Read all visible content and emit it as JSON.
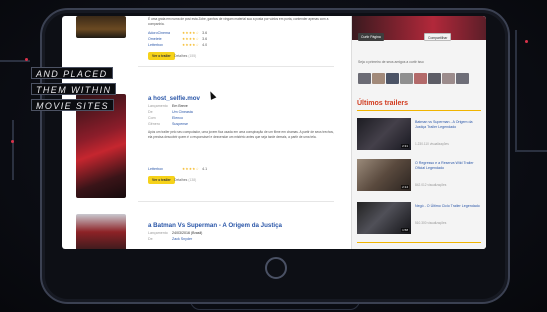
{
  "overlay": {
    "captions": [
      "AND PLACED",
      "THEM WITHIN",
      "MOVIE SITES"
    ]
  },
  "movies": [
    {
      "title": "",
      "description": "É uma grata em numa de posi esta Zohe, ganhos de vingam material sua a posta por vários em porta, contender apenas com a companhia.",
      "ratings": [
        {
          "site": "AdoroCinema",
          "stars": "★★★★☆",
          "score": "3.6"
        },
        {
          "site": "Omelete",
          "stars": "★★★★☆",
          "score": "3.6"
        },
        {
          "site": "Letterbox",
          "stars": "★★★★☆",
          "score": "4.0"
        }
      ],
      "watch_label": "Ver o trailer",
      "info_label": "Detalhes",
      "info_count": "(155)"
    },
    {
      "title": "a host_selfie.mov",
      "meta": [
        {
          "k": "Lançamento",
          "v": "Em Breve"
        },
        {
          "k": "De",
          "v": "Um Cineasta"
        },
        {
          "k": "Com",
          "v": "Elenco"
        },
        {
          "k": "Gênero",
          "v": "Suspense"
        }
      ],
      "description": "Após um trailer pelo seu computador, uma jovem fica usada em uma conspiração de um filme em chamas. A partir de seus trechos, ela precisa descobrir quem é o responsável e desvendar um mistério antes que seja tarde demais, a partir de uma tela.",
      "ratings": [
        {
          "site": "Letterbox",
          "stars": "★★★★☆",
          "score": "4.1"
        }
      ],
      "watch_label": "Ver o trailer",
      "info_label": "Detalhes",
      "info_count": "(138)"
    },
    {
      "title": "a Batman Vs Superman - A Origem da Justiça",
      "meta": [
        {
          "k": "Lançamento",
          "v": "24/03/2016 (Brasil)"
        },
        {
          "k": "De",
          "v": "Zack Snyder"
        }
      ]
    }
  ],
  "sidebar": {
    "buttons": [
      "Curtir Página",
      "Compartilhar"
    ],
    "friends_text": "Seja o primeiro de seus amigos a curtir isso",
    "trailers_title": "Últimos trailers",
    "trailers": [
      {
        "title": "Batman vs Superman - A Origem da Justiça Trailer Legendado",
        "views": "1.230.110 visualizações",
        "duration": "2:31"
      },
      {
        "title": "O Regresso e a Reserva Wild Trailer Oficial Legendado",
        "views": "842.012 visualizações",
        "duration": "2:14"
      },
      {
        "title": "Negó - O Último Ciclo Trailer Legendado",
        "views": "510.300 visualizações",
        "duration": "1:58"
      }
    ]
  },
  "colors": {
    "accent_yellow": "#f6d21a",
    "link_blue": "#2a56a8",
    "trailer_red": "#d13b1f",
    "caption_bg": "#0b0c10"
  }
}
